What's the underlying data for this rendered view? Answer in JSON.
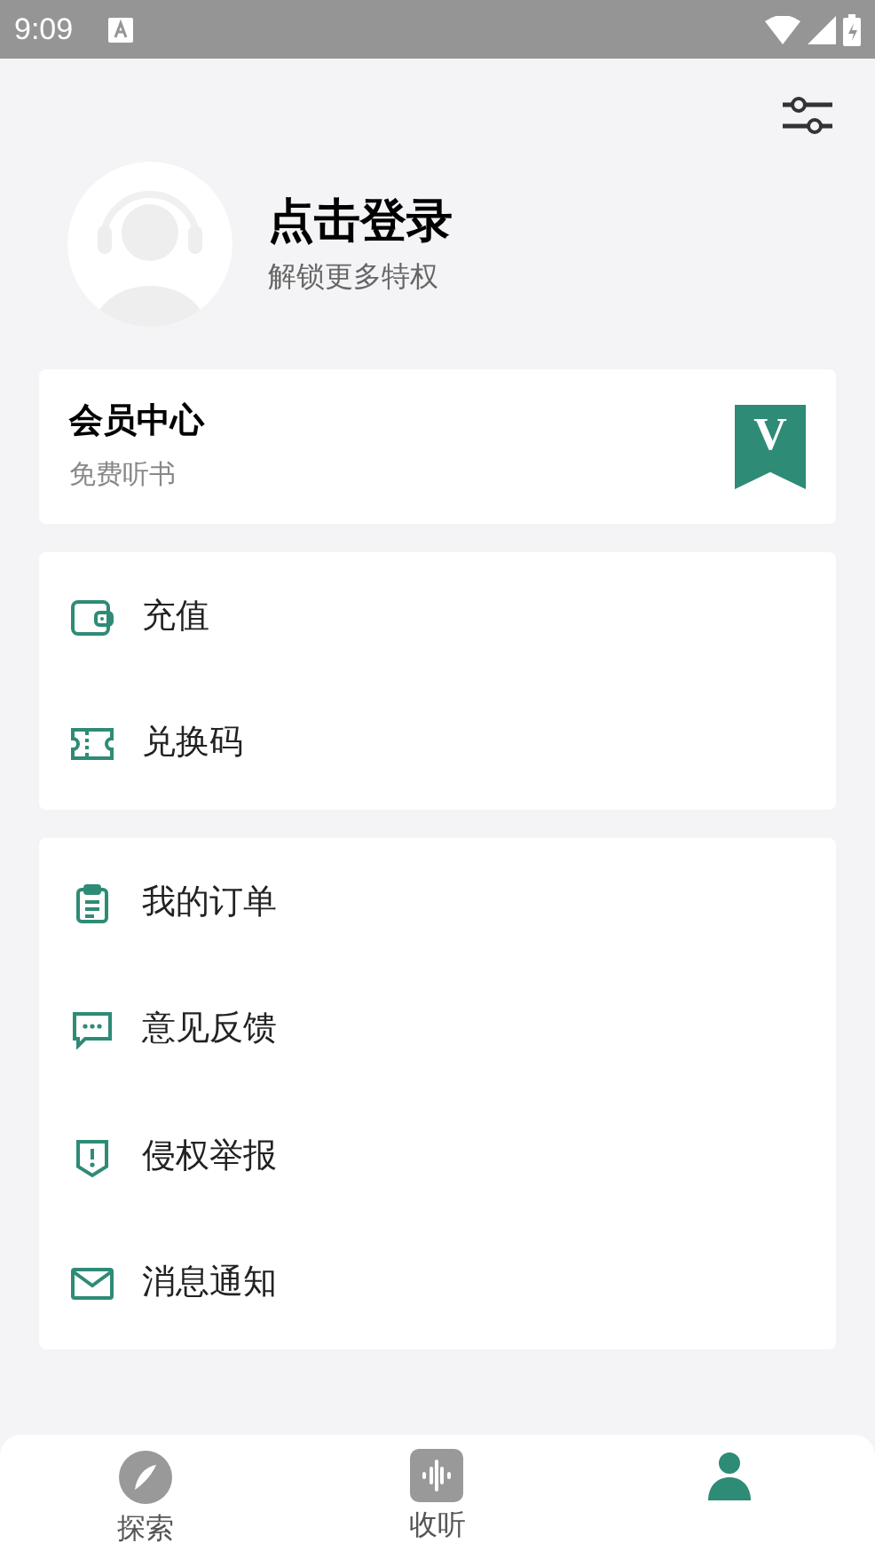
{
  "status_bar": {
    "time": "9:09"
  },
  "profile": {
    "title": "点击登录",
    "subtitle": "解锁更多特权"
  },
  "member": {
    "title": "会员中心",
    "subtitle": "免费听书",
    "badge": "V"
  },
  "groups": [
    {
      "items": [
        {
          "kind": "wallet",
          "label": "充值"
        },
        {
          "kind": "ticket",
          "label": "兑换码"
        }
      ]
    },
    {
      "items": [
        {
          "kind": "clipboard",
          "label": "我的订单"
        },
        {
          "kind": "chat",
          "label": "意见反馈"
        },
        {
          "kind": "shield",
          "label": "侵权举报"
        },
        {
          "kind": "mail",
          "label": "消息通知"
        }
      ]
    }
  ],
  "tabs": [
    {
      "kind": "compass",
      "label": "探索",
      "selected": false
    },
    {
      "kind": "sound",
      "label": "收听",
      "selected": false
    },
    {
      "kind": "person",
      "selected": true
    }
  ]
}
